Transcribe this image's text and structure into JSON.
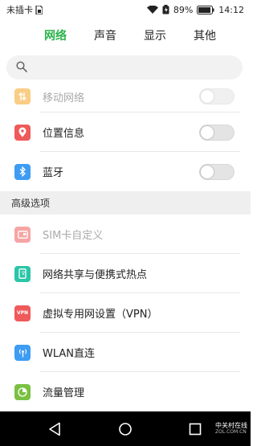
{
  "status_bar": {
    "carrier": "未插卡",
    "battery_percent": "89%",
    "time": "14:12",
    "icons": [
      "sim-card-icon",
      "wifi-icon",
      "battery-icon"
    ]
  },
  "tabs": [
    {
      "label": "网络",
      "active": true
    },
    {
      "label": "声音",
      "active": false
    },
    {
      "label": "显示",
      "active": false
    },
    {
      "label": "其他",
      "active": false
    }
  ],
  "search": {
    "placeholder": "",
    "icon": "search-icon"
  },
  "network_items": [
    {
      "label": "移动网络",
      "icon": "mobile-data-icon",
      "color": "#f5a623",
      "toggle": false,
      "disabled": true
    },
    {
      "label": "位置信息",
      "icon": "location-icon",
      "color": "#ef5a5a",
      "toggle": false,
      "disabled": false
    },
    {
      "label": "蓝牙",
      "icon": "bluetooth-icon",
      "color": "#3e9cf2",
      "toggle": false,
      "disabled": false
    }
  ],
  "advanced": {
    "header": "高级选项",
    "items": [
      {
        "label": "SIM卡自定义",
        "icon": "sim-icon",
        "color": "#ef5a5a",
        "disabled": true
      },
      {
        "label": "网络共享与便携式热点",
        "icon": "hotspot-icon",
        "color": "#2bc6a8",
        "disabled": false
      },
      {
        "label": "虚拟专用网设置（VPN）",
        "icon": "vpn-icon",
        "icon_text": "VPN",
        "color": "#ef5a5a",
        "disabled": false
      },
      {
        "label": "WLAN直连",
        "icon": "wlan-direct-icon",
        "color": "#3e9cf2",
        "disabled": false
      },
      {
        "label": "流量管理",
        "icon": "data-usage-icon",
        "color": "#7ac142",
        "disabled": false
      }
    ]
  },
  "watermark": {
    "brand": "中关村在线",
    "domain": "ZOL.COM.CN"
  },
  "colors": {
    "accent": "#2cb24a",
    "navbar": "#000000"
  }
}
